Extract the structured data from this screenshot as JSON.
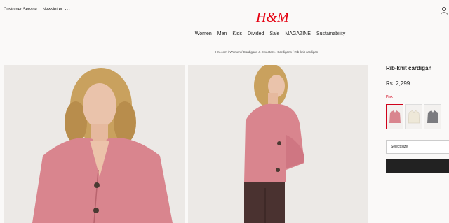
{
  "header": {
    "links": [
      "Customer Service",
      "Newsletter"
    ],
    "more_icon": "more-dots-icon",
    "account_icon": "user-icon",
    "logo_text": "H&M",
    "logo_color": "#e50010"
  },
  "nav": [
    "Women",
    "Men",
    "Kids",
    "Divided",
    "Sale",
    "MAGAZINE",
    "Sustainability"
  ],
  "breadcrumb": "HM.com / Women / Cardigans & Sweaters / Cardigans / Rib-knit cardigan",
  "product": {
    "name": "Rib-knit cardigan",
    "price": "Rs. 2,299",
    "color_label": "Pink",
    "swatches": [
      {
        "color": "#d9858e",
        "selected": true
      },
      {
        "color": "#eee8d8",
        "selected": false
      },
      {
        "color": "#7b7b7f",
        "selected": false
      }
    ],
    "size_placeholder": "Select size"
  }
}
